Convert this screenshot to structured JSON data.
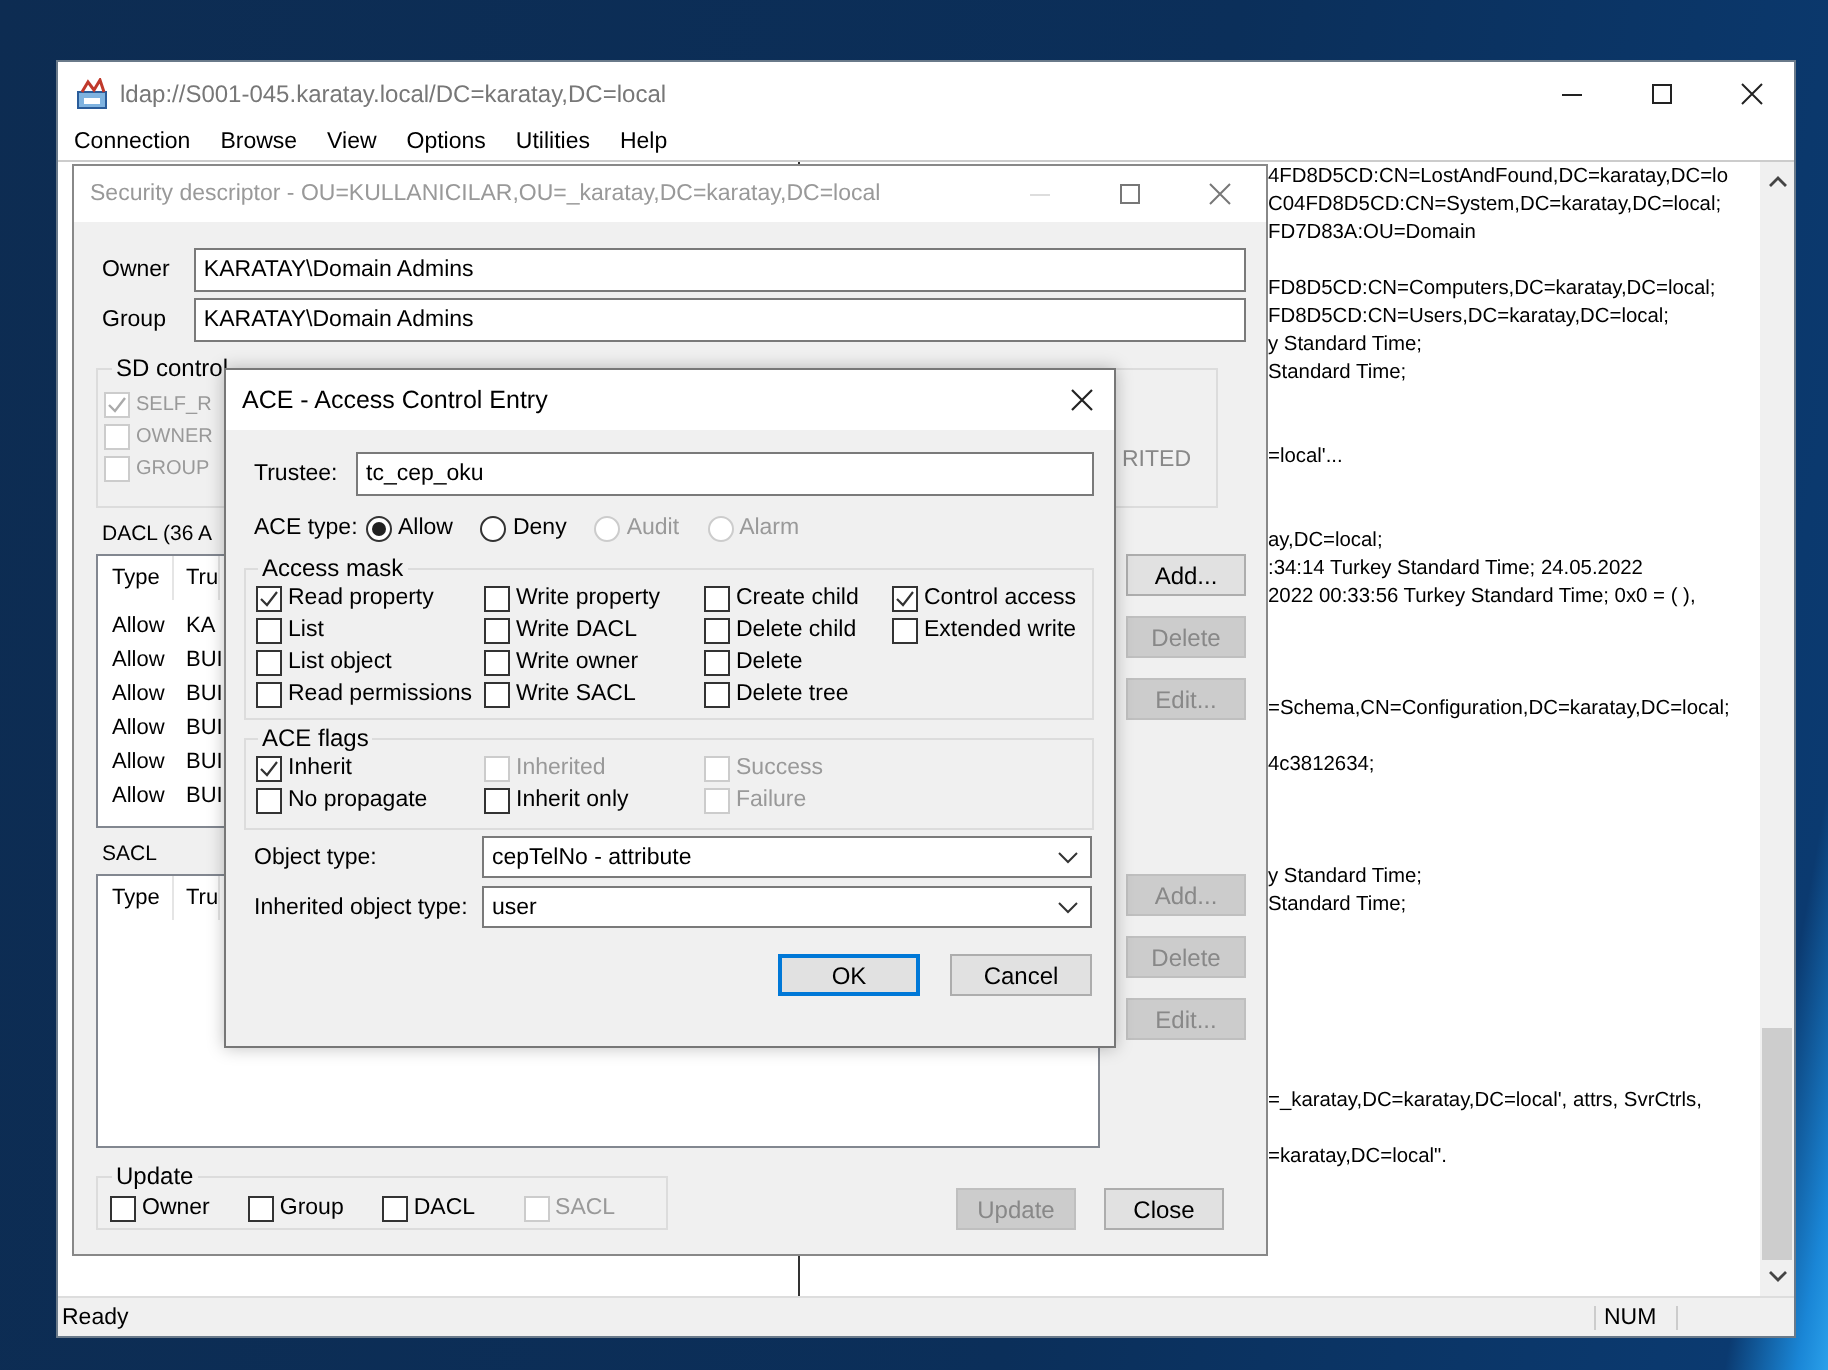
{
  "main_window": {
    "title": "ldap://S001-045.karatay.local/DC=karatay,DC=local",
    "menu": [
      "Connection",
      "Browse",
      "View",
      "Options",
      "Utilities",
      "Help"
    ],
    "output": [
      {
        "kind": "text",
        "text": "4FD8D5CD:CN=LostAndFound,DC=karatay,DC=lo"
      },
      {
        "kind": "text",
        "text": "C04FD8D5CD:CN=System,DC=karatay,DC=local;"
      },
      {
        "kind": "text",
        "text": "FD7D83A:OU=Domain"
      },
      {
        "kind": "blank"
      },
      {
        "kind": "text",
        "text": "FD8D5CD:CN=Computers,DC=karatay,DC=local;"
      },
      {
        "kind": "text",
        "text": "FD8D5CD:CN=Users,DC=karatay,DC=local;"
      },
      {
        "kind": "text",
        "text": "y Standard Time;"
      },
      {
        "kind": "text",
        "text": "Standard Time;"
      },
      {
        "kind": "blank"
      },
      {
        "kind": "blank"
      },
      {
        "kind": "text",
        "text": "=local'..."
      },
      {
        "kind": "blank"
      },
      {
        "kind": "blank"
      },
      {
        "kind": "text",
        "text": "ay,DC=local;"
      },
      {
        "kind": "text",
        "text": ":34:14 Turkey Standard Time; 24.05.2022"
      },
      {
        "kind": "text",
        "text": "2022 00:33:56 Turkey Standard Time; 0x0 = (  ),"
      },
      {
        "kind": "blank"
      },
      {
        "kind": "blank"
      },
      {
        "kind": "blank"
      },
      {
        "kind": "text",
        "text": "=Schema,CN=Configuration,DC=karatay,DC=local;"
      },
      {
        "kind": "blank"
      },
      {
        "kind": "text",
        "text": "4c3812634;"
      },
      {
        "kind": "blank"
      },
      {
        "kind": "blank"
      },
      {
        "kind": "blank"
      },
      {
        "kind": "text",
        "text": "y Standard Time;"
      },
      {
        "kind": "text",
        "text": "Standard Time;"
      },
      {
        "kind": "blank"
      },
      {
        "kind": "blank"
      },
      {
        "kind": "blank"
      },
      {
        "kind": "blank"
      },
      {
        "kind": "blank"
      },
      {
        "kind": "blank"
      },
      {
        "kind": "text",
        "text": "=_karatay,DC=karatay,DC=local', attrs, SvrCtrls,"
      },
      {
        "kind": "blank"
      },
      {
        "kind": "text",
        "text": "=karatay,DC=local\"."
      }
    ],
    "status_bar": {
      "text": "Ready",
      "num": "NUM"
    }
  },
  "security_dialog": {
    "title": "Security descriptor - OU=KULLANICILAR,OU=_karatay,DC=karatay,DC=local",
    "owner_label": "Owner",
    "owner": "KARATAY\\Domain Admins",
    "group_label": "Group",
    "group": "KARATAY\\Domain Admins",
    "sd_control": {
      "title": "SD control",
      "items": [
        {
          "label": "SELF_R",
          "checked": true,
          "disabled": true
        },
        {
          "label": "OWNER",
          "checked": false,
          "disabled": true
        },
        {
          "label": "GROUP",
          "checked": false,
          "disabled": true
        }
      ],
      "side_text": "RITED"
    },
    "dacl": {
      "label": "DACL (36 A",
      "columns": [
        "Type",
        "Tru"
      ],
      "rows": [
        [
          "Allow",
          "KA"
        ],
        [
          "Allow",
          "BUI"
        ],
        [
          "Allow",
          "BUI"
        ],
        [
          "Allow",
          "BUI"
        ],
        [
          "Allow",
          "BUI"
        ],
        [
          "Allow",
          "BUI"
        ]
      ],
      "buttons": [
        {
          "label": "Add...",
          "disabled": false
        },
        {
          "label": "Delete",
          "disabled": true
        },
        {
          "label": "Edit...",
          "disabled": true
        }
      ]
    },
    "sacl": {
      "label": "SACL",
      "columns": [
        "Type",
        "Tru"
      ],
      "buttons": [
        {
          "label": "Add...",
          "disabled": true
        },
        {
          "label": "Delete",
          "disabled": true
        },
        {
          "label": "Edit...",
          "disabled": true
        }
      ]
    },
    "update_group": {
      "title": "Update",
      "items": [
        {
          "label": "Owner",
          "checked": false,
          "disabled": false
        },
        {
          "label": "Group",
          "checked": false,
          "disabled": false
        },
        {
          "label": "DACL",
          "checked": false,
          "disabled": false
        },
        {
          "label": "SACL",
          "checked": false,
          "disabled": true
        }
      ]
    },
    "buttons": [
      {
        "label": "Update",
        "disabled": true
      },
      {
        "label": "Close",
        "disabled": false
      }
    ]
  },
  "ace_dialog": {
    "title": "ACE - Access Control Entry",
    "trustee_label": "Trustee:",
    "trustee": "tc_cep_oku",
    "ace_type": {
      "label": "ACE type:",
      "options": [
        {
          "label": "Allow",
          "selected": true,
          "disabled": false
        },
        {
          "label": "Deny",
          "selected": false,
          "disabled": false
        },
        {
          "label": "Audit",
          "selected": false,
          "disabled": true
        },
        {
          "label": "Alarm",
          "selected": false,
          "disabled": true
        }
      ]
    },
    "access_mask": {
      "title": "Access mask",
      "columns": [
        [
          {
            "label": "Read property",
            "checked": true,
            "disabled": false
          },
          {
            "label": "List",
            "checked": false,
            "disabled": false
          },
          {
            "label": "List object",
            "checked": false,
            "disabled": false
          },
          {
            "label": "Read permissions",
            "checked": false,
            "disabled": false
          }
        ],
        [
          {
            "label": "Write property",
            "checked": false,
            "disabled": false
          },
          {
            "label": "Write DACL",
            "checked": false,
            "disabled": false
          },
          {
            "label": "Write owner",
            "checked": false,
            "disabled": false
          },
          {
            "label": "Write SACL",
            "checked": false,
            "disabled": false
          }
        ],
        [
          {
            "label": "Create child",
            "checked": false,
            "disabled": false
          },
          {
            "label": "Delete child",
            "checked": false,
            "disabled": false
          },
          {
            "label": "Delete",
            "checked": false,
            "disabled": false
          },
          {
            "label": "Delete tree",
            "checked": false,
            "disabled": false
          }
        ],
        [
          {
            "label": "Control access",
            "checked": true,
            "disabled": false
          },
          {
            "label": "Extended write",
            "checked": false,
            "disabled": false
          }
        ]
      ]
    },
    "ace_flags": {
      "title": "ACE flags",
      "columns": [
        [
          {
            "label": "Inherit",
            "checked": true,
            "disabled": false
          },
          {
            "label": "No propagate",
            "checked": false,
            "disabled": false
          }
        ],
        [
          {
            "label": "Inherited",
            "checked": false,
            "disabled": true
          },
          {
            "label": "Inherit only",
            "checked": false,
            "disabled": false
          }
        ],
        [
          {
            "label": "Success",
            "checked": false,
            "disabled": true
          },
          {
            "label": "Failure",
            "checked": false,
            "disabled": true
          }
        ]
      ]
    },
    "object_type_label": "Object type:",
    "object_type": "cepTelNo - attribute",
    "inherited_object_type_label": "Inherited object type:",
    "inherited_object_type": "user",
    "buttons": [
      {
        "label": "OK",
        "default": true
      },
      {
        "label": "Cancel",
        "default": false
      }
    ]
  }
}
